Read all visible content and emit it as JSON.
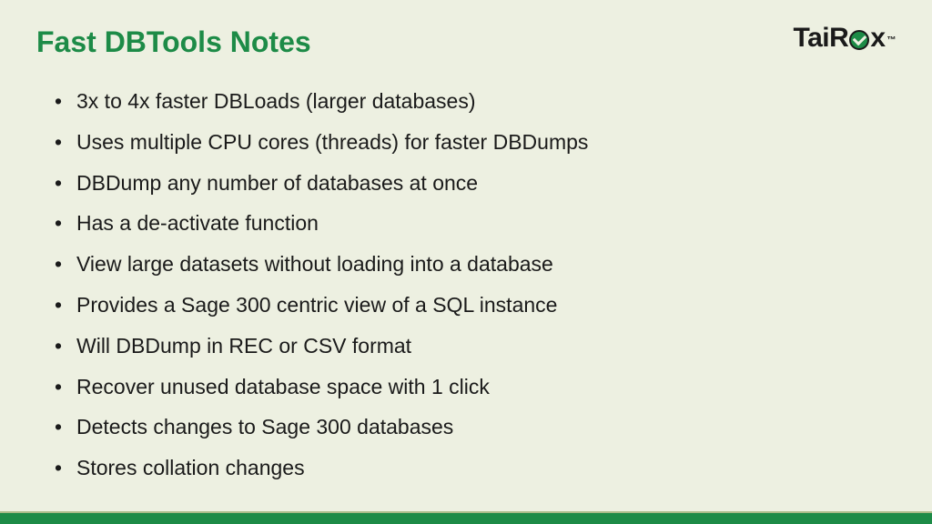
{
  "title": "Fast DBTools Notes",
  "logo": {
    "part1": "TaiR",
    "part2": "x",
    "tm": "™"
  },
  "bullets": [
    "3x to 4x faster DBLoads (larger databases)",
    "Uses multiple CPU cores (threads) for faster DBDumps",
    "DBDump any number of databases at once",
    "Has a de-activate function",
    "View large datasets without loading into a database",
    "Provides a Sage 300 centric view of a SQL instance",
    "Will DBDump in REC or CSV format",
    "Recover unused database space with 1 click",
    "Detects changes to Sage 300 databases",
    "Stores collation changes"
  ]
}
